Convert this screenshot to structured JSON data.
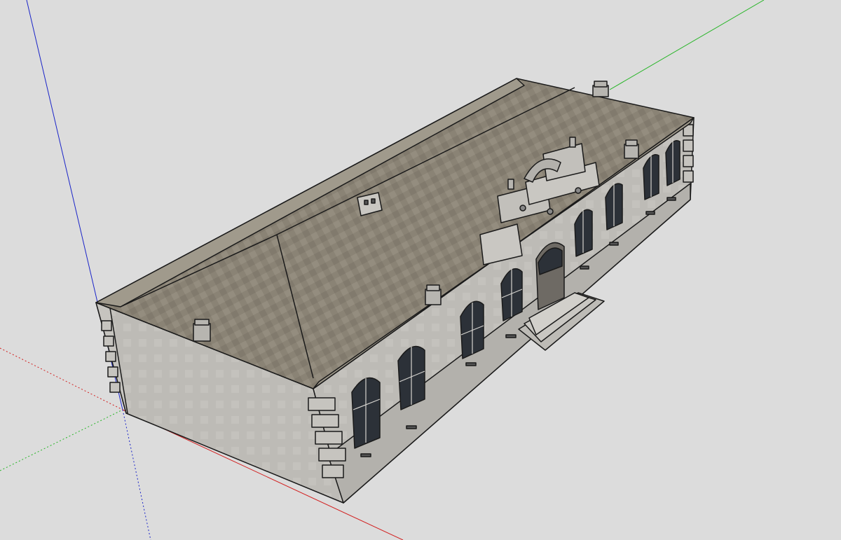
{
  "viewport": {
    "background": "#dcdcdc"
  },
  "axes": {
    "blue": "#1a24c8",
    "green": "#26b526",
    "red": "#d21f1f"
  },
  "model": {
    "roof_color": "#8a8375",
    "roof_light": "#9c9586",
    "wall_color": "#bdbbb6",
    "wall_light": "#c9c7c2",
    "trim_color": "#a9a7a1",
    "window_glass": "#2c3138",
    "edge_color": "#1a1a1a"
  }
}
